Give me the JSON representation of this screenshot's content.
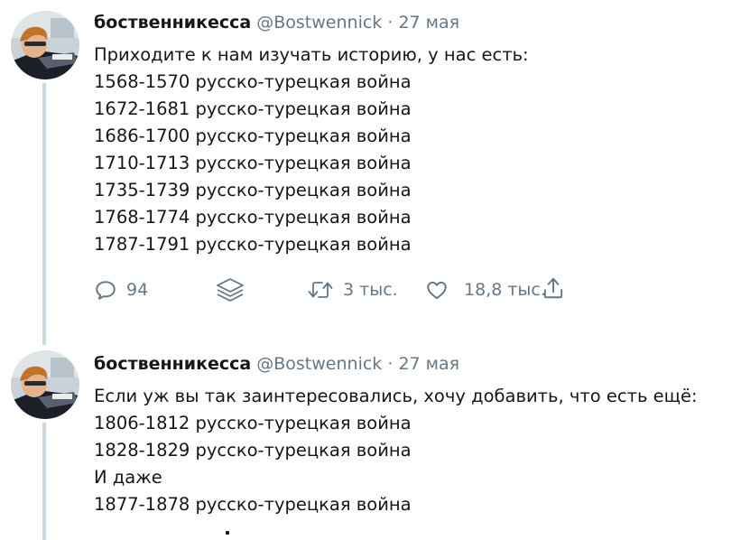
{
  "tweets": [
    {
      "name": "боственникесса",
      "handle": "@Bostwennick",
      "dot": "·",
      "date": "27 мая",
      "lines": [
        "Приходите к нам изучать историю, у нас есть:",
        "1568-1570 русско-турецкая война",
        "1672-1681 русско-турецкая война",
        "1686-1700 русско-турецкая война",
        "1710-1713 русско-турецкая война",
        "1735-1739 русско-турецкая война",
        "1768-1774 русско-турецкая война",
        "1787-1791 русско-турецкая война"
      ],
      "actions": {
        "replies": "94",
        "retweets": "3 тыс.",
        "likes": "18,8 тыс."
      }
    },
    {
      "name": "боственникесса",
      "handle": "@Bostwennick",
      "dot": "·",
      "date": "27 мая",
      "lines": [
        "Если уж вы так заинтересовались, хочу добавить, что есть ещё:",
        "1806-1812 русско-турецкая война",
        "1828-1829 русско-турецкая война",
        "И даже",
        "1877-1878 русско-турецкая война"
      ]
    }
  ],
  "icons": {
    "reply": "reply-icon",
    "layers": "layers-icon",
    "retweet": "retweet-icon",
    "like": "heart-icon",
    "share": "share-icon"
  }
}
